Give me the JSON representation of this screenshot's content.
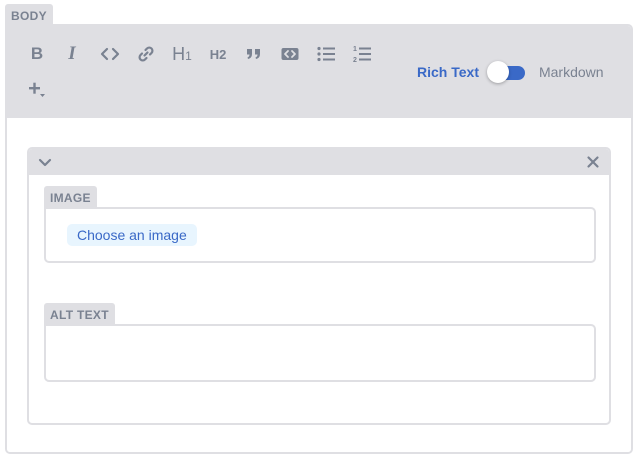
{
  "body_field": {
    "label": "BODY"
  },
  "toolbar": {
    "buttons": [
      {
        "name": "bold-button",
        "icon": "bold-icon",
        "glyph": "B"
      },
      {
        "name": "italic-button",
        "icon": "italic-icon",
        "glyph": "I"
      },
      {
        "name": "code-button",
        "icon": "code-icon"
      },
      {
        "name": "link-button",
        "icon": "link-icon"
      },
      {
        "name": "heading-one-button",
        "icon": "heading-one-icon",
        "glyph": "H1"
      },
      {
        "name": "heading-two-button",
        "icon": "heading-two-icon",
        "glyph": "H2"
      },
      {
        "name": "quote-button",
        "icon": "quote-icon"
      },
      {
        "name": "code-block-button",
        "icon": "code-block-icon"
      },
      {
        "name": "bulleted-list-button",
        "icon": "bulleted-list-icon"
      },
      {
        "name": "numbered-list-button",
        "icon": "numbered-list-icon"
      },
      {
        "name": "add-component-button",
        "icon": "plus-dropdown-icon"
      }
    ],
    "mode": {
      "rich_text_label": "Rich Text",
      "markdown_label": "Markdown",
      "active": "Rich Text"
    }
  },
  "image_widget": {
    "image_field": {
      "label": "IMAGE",
      "button_label": "Choose an image"
    },
    "alt_field": {
      "label": "ALT TEXT",
      "value": ""
    }
  },
  "colors": {
    "accent": "#3a69c7",
    "chrome": "#dfdfe3",
    "muted_text": "#7a8291",
    "button_bg": "#e8f5fe"
  }
}
